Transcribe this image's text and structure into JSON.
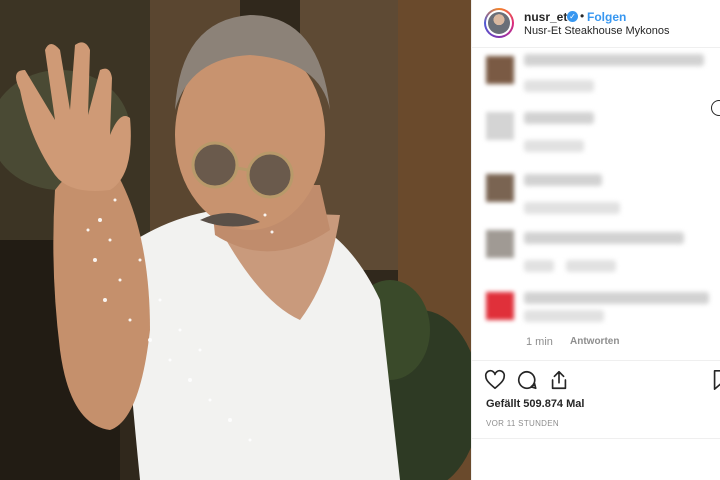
{
  "post": {
    "photo_alt": "",
    "header": {
      "username": "nusr_et",
      "separator": "•",
      "follow_label": "Folgen",
      "location": "Nusr-Et Steakhouse Mykonos"
    },
    "comments": {
      "last_time": "1 min",
      "reply_label": "Antworten"
    },
    "actions": {
      "like_icon": "heart-icon",
      "comment_icon": "comment-icon",
      "share_icon": "share-icon",
      "save_icon": "bookmark-icon"
    },
    "likes_text": "Gefällt 509.874 Mal",
    "timestamp": "VOR 11 STUNDEN"
  },
  "colors": {
    "link_blue": "#3897f0",
    "text_dark": "#262626",
    "text_muted": "#8e8e8e",
    "divider": "#efefef"
  }
}
